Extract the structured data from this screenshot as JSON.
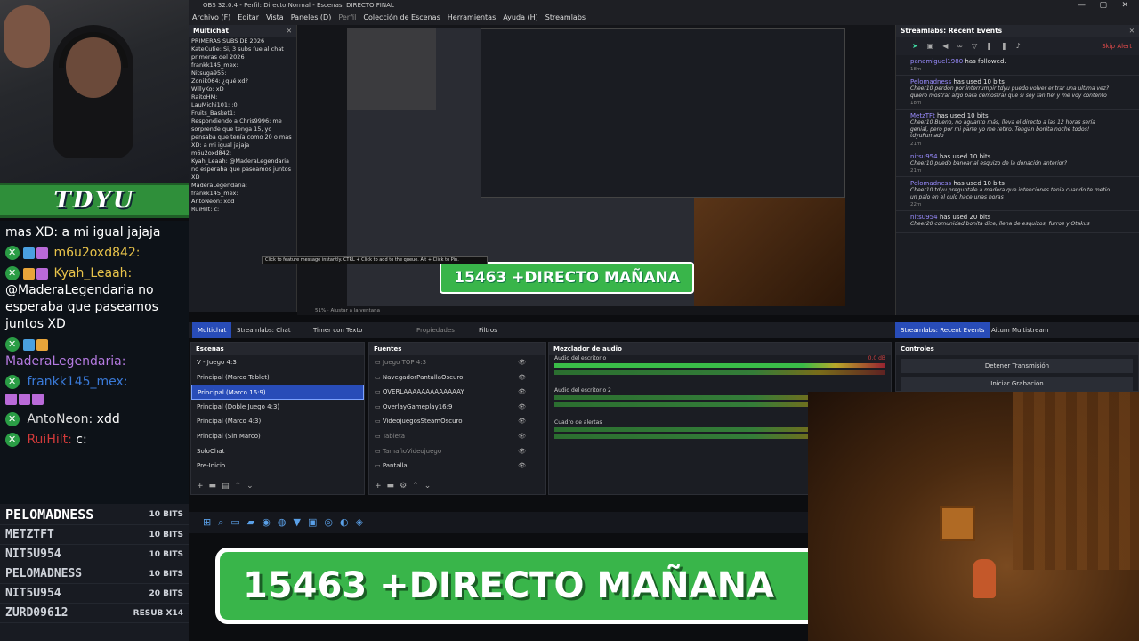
{
  "overlay": {
    "banner": "TDYU",
    "chat": [
      {
        "user": "",
        "text": "mas XD: a mi igual jajaja"
      },
      {
        "user": "m6u2oxd842:",
        "text": ""
      },
      {
        "user": "Kyah_Leaah:",
        "text": "@MaderaLegendaria no esperaba que paseamos juntos XD"
      },
      {
        "user": "MaderaLegendaria:",
        "text": ""
      },
      {
        "user": "frankk145_mex:",
        "text": ""
      },
      {
        "user": "AntoNeon:",
        "text": "xdd"
      },
      {
        "user": "RuiHilt:",
        "text": "c:"
      }
    ],
    "bits": [
      {
        "name": "PELOMADNESS",
        "amount": "10 BITS"
      },
      {
        "name": "METZTFT",
        "amount": "10 BITS"
      },
      {
        "name": "NIT5U954",
        "amount": "10 BITS"
      },
      {
        "name": "PELOMADNESS",
        "amount": "10 BITS"
      },
      {
        "name": "NIT5U954",
        "amount": "20 BITS"
      },
      {
        "name": "ZURD09612",
        "amount": "RESUB X14"
      }
    ]
  },
  "obs": {
    "title": "OBS 32.0.4 - Perfil: Directo Normal - Escenas: DIRECTO FINAL",
    "menu": [
      "Archivo (F)",
      "Editar",
      "Vista",
      "Paneles (D)",
      "Perfil",
      "Colección de Escenas",
      "Herramientas",
      "Ayuda (H)",
      "Streamlabs"
    ],
    "multichat": {
      "title": "Multichat",
      "lines": [
        "PRIMERAS SUBS DE 2026",
        "KateCutie: Si, 3 subs fue al chat primeras del 2026",
        "frankk145_mex:",
        "Nitsuga955:",
        "Zonik064: ¿qué xd?",
        "WillyKo: xD",
        "RaitoHM:",
        "LauMichi101: :0",
        "Fruits_Basket1:",
        "Respondiendo a Chris9996: me sorprende que tenga 15, yo pensaba que tenía como 20 o mas XD: a mi igual jajaja",
        "m6u2oxd842:",
        "Kyah_Leaah: @MaderaLegendaria no esperaba que paseamos juntos XD",
        "MaderaLegendaria:",
        "frankk145_mex:",
        "AntoNeon: xdd",
        "RuiHilt: c:"
      ]
    },
    "preview_banner": "15463 +DIRECTO MAÑANA",
    "tooltip": "Click to feature message instantly. CTRL + Click to add to the queue. Alt + Click to Pin.",
    "zoom": "51%",
    "zoom_label": "Ajustar a la ventana",
    "events": {
      "title": "Streamlabs: Recent Events",
      "skip": "Skip Alert",
      "items": [
        {
          "user": "panamiguel1980",
          "action": "has followed.",
          "msg": "",
          "time": "18m"
        },
        {
          "user": "Pelomadness",
          "action": "has used 10 bits",
          "msg": "Cheer10 perdon por interrumpir tdyu puedo volver entrar una ultima vez? quiero mostrar algo para demostrar que si soy fan fiel y me voy contento",
          "time": "18m"
        },
        {
          "user": "MetzTFt",
          "action": "has used 10 bits",
          "msg": "Cheer10 Bueno, no aguanto más, lleva el directo a las 12 horas sería genial, pero por mi parte yo me retiro. Tengan bonita noche todos! tdyuFumado",
          "time": "21m"
        },
        {
          "user": "nitsu954",
          "action": "has used 10 bits",
          "msg": "Cheer10 puedo banear al esquizo de la donación anterior?",
          "time": "21m"
        },
        {
          "user": "Pelomadness",
          "action": "has used 10 bits",
          "msg": "Cheer10 tdyu preguntale a madera que intenciones tenia cuando te metio un palo en el culo hace unas horas",
          "time": "22m"
        },
        {
          "user": "nitsu954",
          "action": "has used 20 bits",
          "msg": "Cheer20 comunidad bonita dice, llena de esquizos, furros y Otakus",
          "time": ""
        }
      ]
    },
    "tabs": [
      "Multichat",
      "Streamlabs: Chat",
      "Timer con Texto",
      "Propiedades",
      "Filtros"
    ],
    "tabs_right": [
      "Streamlabs: Recent Events",
      "Aitum Multistream"
    ],
    "scenes": {
      "title": "Escenas",
      "items": [
        "V - Juego 4:3",
        "Principal (Marco Tablet)",
        "Principal (Marco 16:9)",
        "Principal (Doble Juego 4:3)",
        "Principal (Marco 4:3)",
        "Principal (Sin Marco)",
        "SoloChat",
        "Pre-Inicio"
      ],
      "selected": 2
    },
    "sources": {
      "title": "Fuentes",
      "items": [
        "Juego TOP 4:3",
        "NavegadorPantallaOscuro",
        "OVERLAAAAAAAAAAAAAY",
        "OverlayGameplay16:9",
        "VideojuegosSteamOscuro",
        "Tableta",
        "TamañoVideojuego",
        "Pantalla"
      ]
    },
    "mixer": {
      "title": "Mezclador de audio",
      "tracks": [
        {
          "name": "Audio del escritorio",
          "db": "0.0 dB"
        },
        {
          "name": "Audio del escritorio 2",
          "db": ""
        },
        {
          "name": "Cuadro de alertas",
          "db": ""
        }
      ]
    },
    "controls": {
      "title": "Controles",
      "buttons": [
        "Detener Transmisión",
        "Iniciar Grabación"
      ]
    }
  },
  "bottom_banner": "15463 +DIRECTO MAÑANA",
  "colors": {
    "accent": "#284cb8",
    "green": "#39b54a",
    "bits_bg": "#181b22"
  }
}
